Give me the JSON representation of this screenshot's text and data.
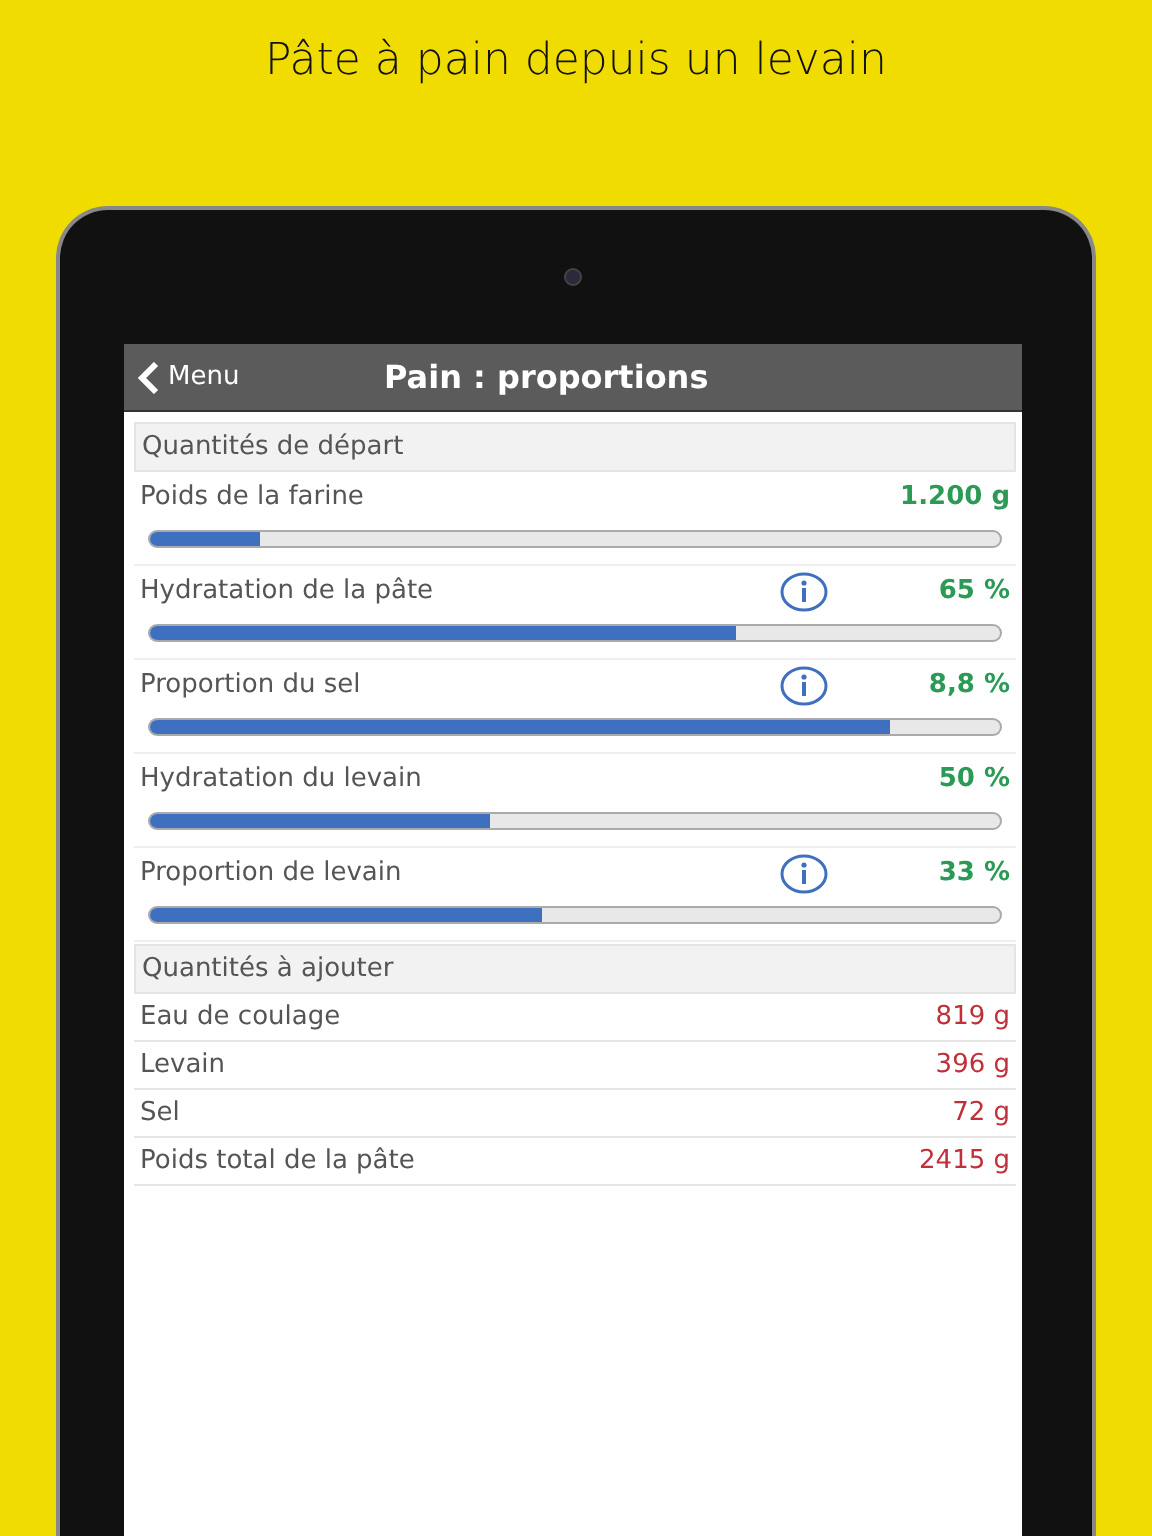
{
  "caption": "Pâte à pain depuis un levain",
  "header": {
    "back": "Menu",
    "title": "Pain : proportions"
  },
  "sections": [
    {
      "title": "Quantités de départ",
      "kind": "sliders",
      "rows": [
        {
          "label": "Poids de la farine",
          "value": "1.200 g",
          "info": false,
          "level": 0.13
        },
        {
          "label": "Hydratation de la pâte",
          "value": "65 %",
          "info": true,
          "level": 0.69
        },
        {
          "label": "Proportion du sel",
          "value": "8,8 %",
          "info": true,
          "level": 0.87
        },
        {
          "label": "Hydratation du levain",
          "value": "50 %",
          "info": false,
          "level": 0.4
        },
        {
          "label": "Proportion de levain",
          "value": "33 %",
          "info": true,
          "level": 0.46
        }
      ]
    },
    {
      "title": "Quantités à ajouter",
      "kind": "results",
      "rows": [
        {
          "label": "Eau de coulage",
          "value": "819 g"
        },
        {
          "label": "Levain",
          "value": "396 g"
        },
        {
          "label": "Sel",
          "value": "72 g"
        },
        {
          "label": "Poids total de la pâte",
          "value": "2415 g"
        }
      ]
    }
  ]
}
